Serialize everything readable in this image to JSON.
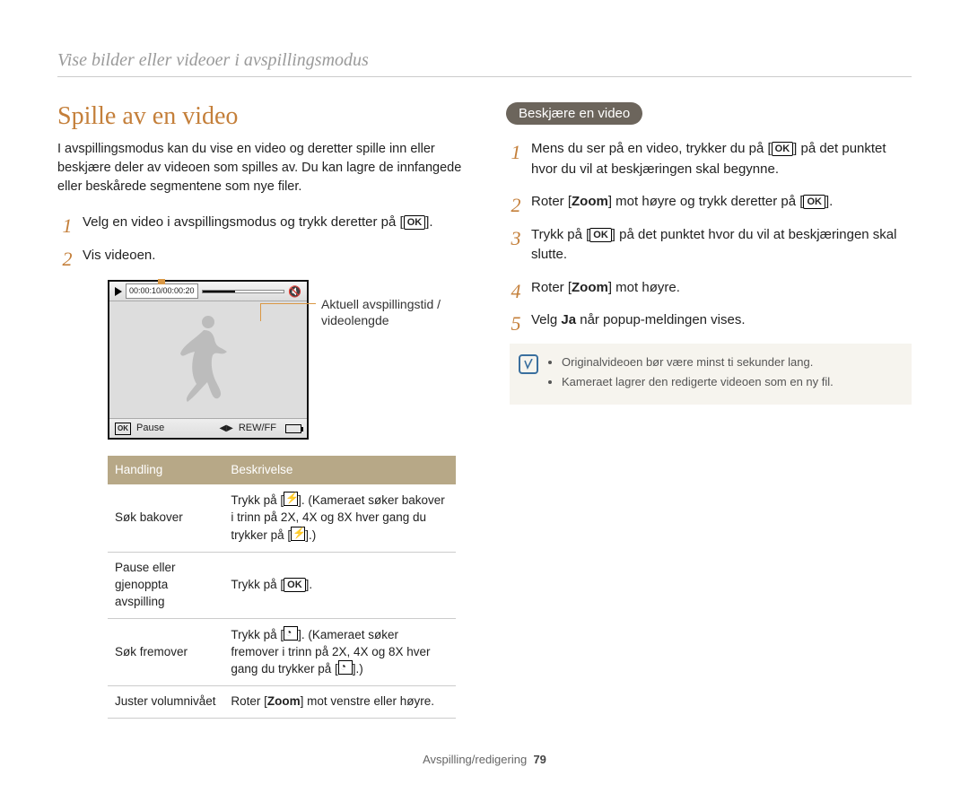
{
  "breadcrumb": "Vise bilder eller videoer i avspillingsmodus",
  "left": {
    "title": "Spille av en video",
    "intro": "I avspillingsmodus kan du vise en video og deretter spille inn eller beskjære deler av videoen som spilles av. Du kan lagre de innfangede eller beskårede segmentene som nye filer.",
    "step1": "Velg en video i avspillingsmodus og trykk deretter på [",
    "step1_end": "].",
    "step2": "Vis videoen.",
    "figure_label_line1": "Aktuell avspillingstid /",
    "figure_label_line2": "videolengde",
    "lcd": {
      "time": "00:00:10/00:00:20",
      "pause": "Pause",
      "rewff": "REW/FF"
    },
    "table": {
      "h1": "Handling",
      "h2": "Beskrivelse",
      "r1c1": "Søk bakover",
      "r1c2_a": "Trykk på [",
      "r1c2_b": "]. (Kameraet søker bakover i trinn på 2X, 4X og 8X hver gang du trykker på [",
      "r1c2_c": "].)",
      "r2c1": "Pause eller gjenoppta avspilling",
      "r2c2_a": "Trykk på [",
      "r2c2_b": "].",
      "r3c1": "Søk fremover",
      "r3c2_a": "Trykk på [",
      "r3c2_b": "]. (Kameraet søker fremover i trinn på 2X, 4X og 8X hver gang du trykker på [",
      "r3c2_c": "].)",
      "r4c1": "Juster volumnivået",
      "r4c2_a": "Roter [",
      "r4c2_zoom": "Zoom",
      "r4c2_b": "] mot venstre eller høyre."
    }
  },
  "right": {
    "pill": "Beskjære en video",
    "s1a": "Mens du ser på en video, trykker du på [",
    "s1b": "] på det punktet hvor du vil at beskjæringen skal begynne.",
    "s2a": "Roter [",
    "s2zoom": "Zoom",
    "s2b": "] mot høyre og trykk deretter på [",
    "s2c": "].",
    "s3a": "Trykk på [",
    "s3b": "] på det punktet hvor du vil at beskjæringen skal slutte.",
    "s4a": "Roter [",
    "s4zoom": "Zoom",
    "s4b": "] mot høyre.",
    "s5a": "Velg ",
    "s5ja": "Ja",
    "s5b": " når popup-meldingen vises.",
    "note1": "Originalvideoen bør være minst ti sekunder lang.",
    "note2": "Kameraet lagrer den redigerte videoen som en ny fil."
  },
  "footer": {
    "label": "Avspilling/redigering",
    "page": "79"
  }
}
